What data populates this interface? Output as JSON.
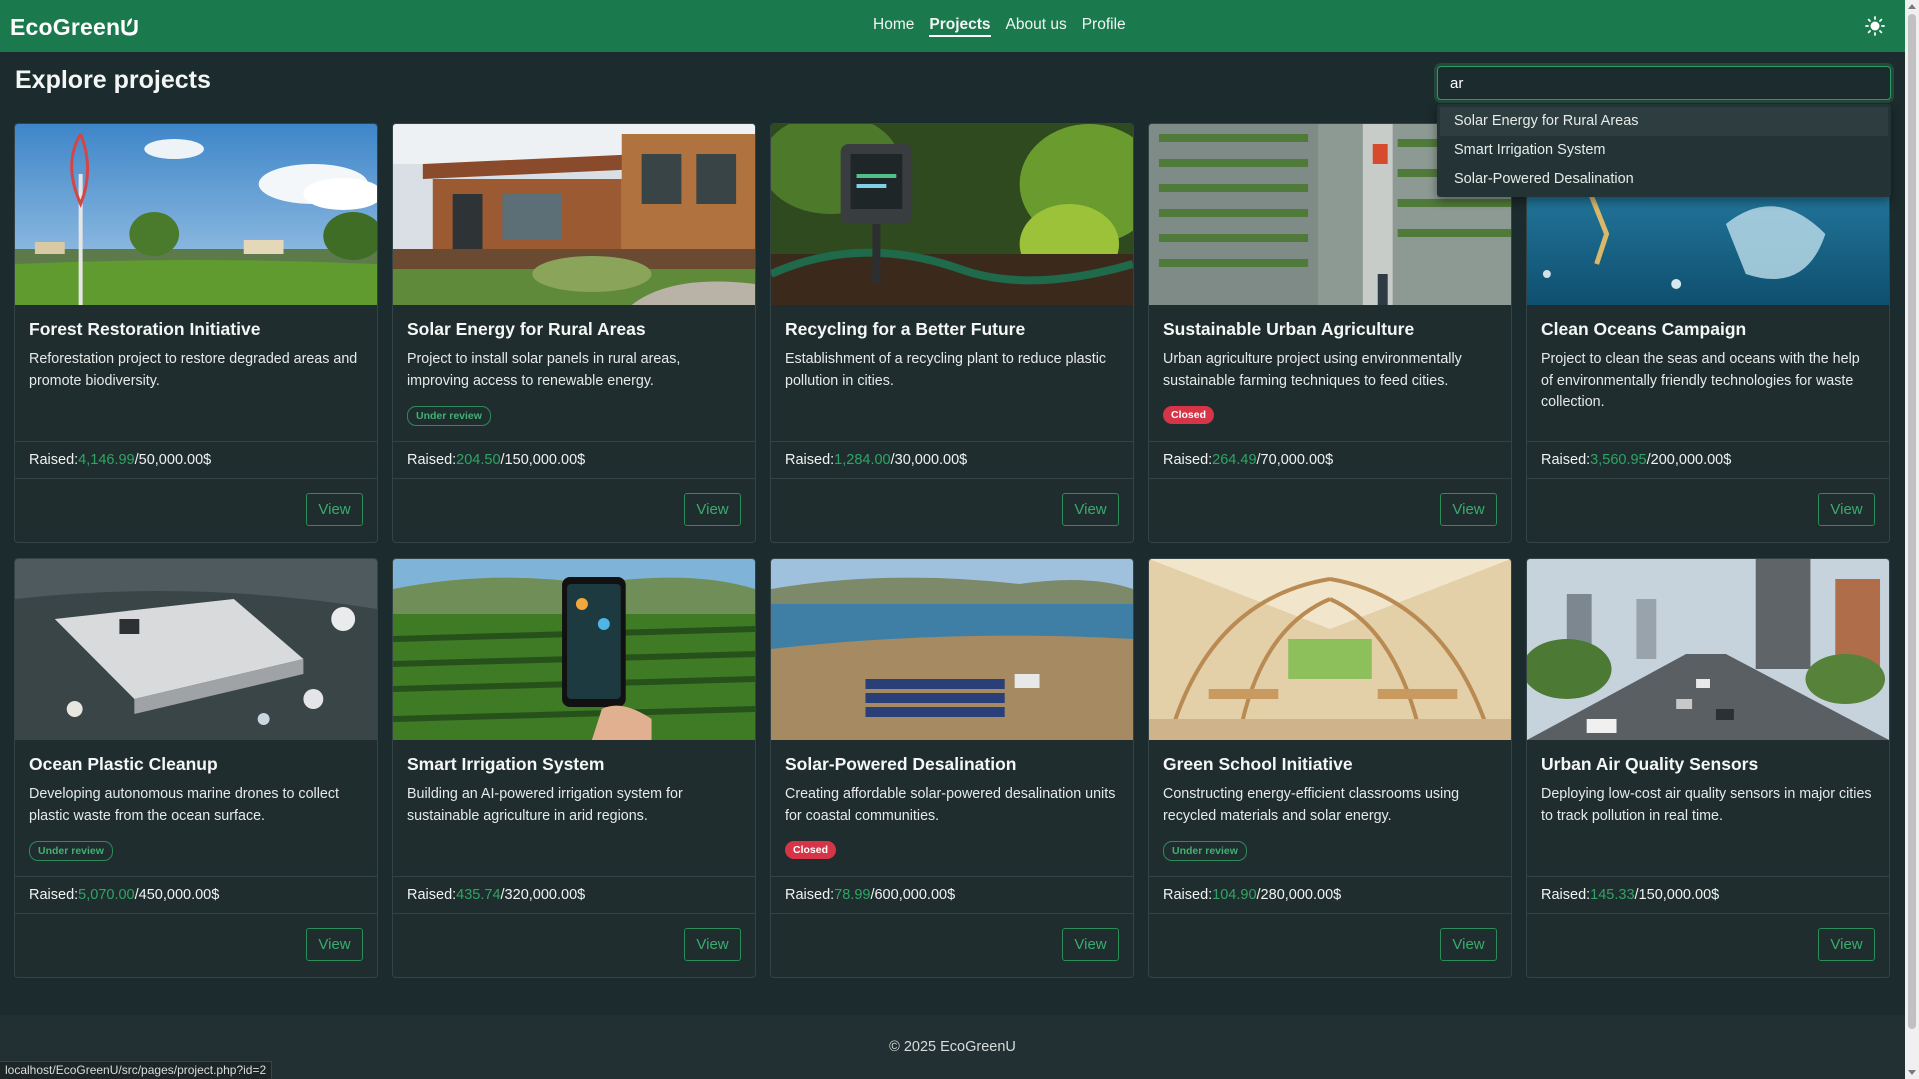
{
  "nav": {
    "brand": "EcoGreen",
    "links": [
      {
        "label": "Home"
      },
      {
        "label": "Projects"
      },
      {
        "label": "About us"
      },
      {
        "label": "Profile"
      }
    ],
    "active_link": "Projects",
    "theme_icon": "sun-icon"
  },
  "header": {
    "title": "Explore projects"
  },
  "search": {
    "value": "ar",
    "suggestions": [
      "Solar Energy for Rural Areas",
      "Smart Irrigation System",
      "Solar-Powered Desalination"
    ]
  },
  "projects": [
    {
      "title": "Forest Restoration Initiative",
      "description": "Reforestation project to restore degraded areas and promote biodiversity.",
      "status": "",
      "raised_label": "Raised: ",
      "raised": "4,146.99",
      "goal": "/50,000.00$",
      "view_label": "View",
      "image": "wind-turbine-meadow"
    },
    {
      "title": "Solar Energy for Rural Areas",
      "description": "Project to install solar panels in rural areas, improving access to renewable energy.",
      "status": "Under review",
      "raised_label": "Raised: ",
      "raised": "204.50",
      "goal": "/150,000.00$",
      "view_label": "View",
      "image": "wooden-house-garden"
    },
    {
      "title": "Recycling for a Better Future",
      "description": "Establishment of a recycling plant to reduce plastic pollution in cities.",
      "status": "",
      "raised_label": "Raised: ",
      "raised": "1,284.00",
      "goal": "/30,000.00$",
      "view_label": "View",
      "image": "soil-sensor-plants"
    },
    {
      "title": "Sustainable Urban Agriculture",
      "description": "Urban agriculture project using environmentally sustainable farming techniques to feed cities.",
      "status": "Closed",
      "raised_label": "Raised: ",
      "raised": "264.49",
      "goal": "/70,000.00$",
      "view_label": "View",
      "image": "vertical-farm"
    },
    {
      "title": "Clean Oceans Campaign",
      "description": "Project to clean the seas and oceans with the help of environmentally friendly technologies for waste collection.",
      "status": "",
      "raised_label": "Raised: ",
      "raised": "3,560.95",
      "goal": "/200,000.00$",
      "view_label": "View",
      "image": "ocean-plastic-bag"
    },
    {
      "title": "Ocean Plastic Cleanup",
      "description": "Developing autonomous marine drones to collect plastic waste from the ocean surface.",
      "status": "Under review",
      "raised_label": "Raised: ",
      "raised": "5,070.00",
      "goal": "/450,000.00$",
      "view_label": "View",
      "image": "marine-drone-waste"
    },
    {
      "title": "Smart Irrigation System",
      "description": "Building an AI-powered irrigation system for sustainable agriculture in arid regions.",
      "status": "",
      "raised_label": "Raised: ",
      "raised": "435.74",
      "goal": "/320,000.00$",
      "view_label": "View",
      "image": "phone-crop-field"
    },
    {
      "title": "Solar-Powered Desalination",
      "description": "Creating affordable solar-powered desalination units for coastal communities.",
      "status": "Closed",
      "raised_label": "Raised: ",
      "raised": "78.99",
      "goal": "/600,000.00$",
      "view_label": "View",
      "image": "solar-panels-coast"
    },
    {
      "title": "Green School Initiative",
      "description": "Constructing energy-efficient classrooms using recycled materials and solar energy.",
      "status": "Under review",
      "raised_label": "Raised: ",
      "raised": "104.90",
      "goal": "/280,000.00$",
      "view_label": "View",
      "image": "wooden-classroom"
    },
    {
      "title": "Urban Air Quality Sensors",
      "description": "Deploying low-cost air quality sensors in major cities to track pollution in real time.",
      "status": "",
      "raised_label": "Raised: ",
      "raised": "145.33",
      "goal": "/150,000.00$",
      "view_label": "View",
      "image": "city-traffic-sensor"
    }
  ],
  "footer": {
    "text": "© 2025 EcoGreenU"
  },
  "status_bar": {
    "url": "localhost/EcoGreenU/src/pages/project.php?id=2"
  },
  "colors": {
    "navbar": "#1b7a4d",
    "background": "#1c2b2d",
    "accent_green": "#2fa564",
    "closed_red": "#d63447"
  }
}
